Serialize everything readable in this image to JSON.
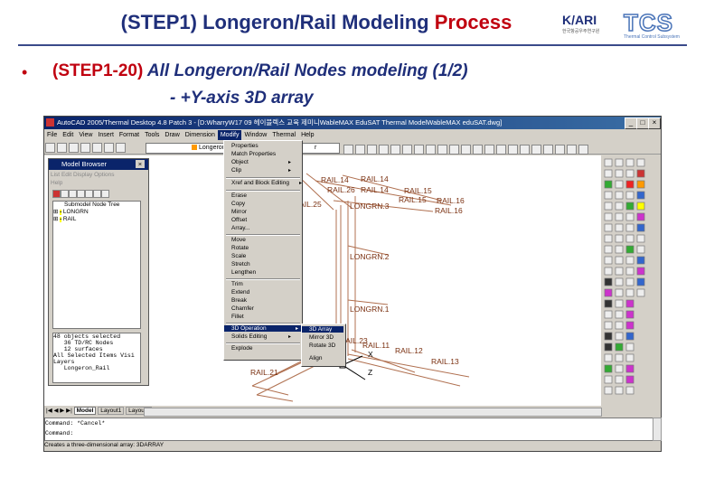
{
  "slide": {
    "title_prefix": "(STEP1) Longeron/Rail Modeling ",
    "title_highlight": "Process",
    "bullet": "•",
    "step_label": "(STEP1-20)",
    "step_text": " All Longeron/Rail Nodes modeling (1/2)",
    "sub_text": "- +Y-axis 3D array",
    "logo_kari": "K/ARI",
    "logo_kari_sub": "한국항공우주연구원",
    "logo_tcs": "TCS",
    "logo_tcs_sub": "Thermal Control Subsystem"
  },
  "window": {
    "title": "AutoCAD 2005/Thermal Desktop 4.8 Patch 3 - [D:WharryW17 09 헤이블렉스 교육 제미니WableMAX EduSAT Thermal ModelWableMAX eduSAT.dwg]",
    "controls": [
      "_",
      "□",
      "×"
    ]
  },
  "menubar": [
    "File",
    "Edit",
    "View",
    "Insert",
    "Format",
    "Tools",
    "Draw",
    "Dimension",
    "Modify",
    "Window",
    "Thermal",
    "Help"
  ],
  "toolbar": {
    "layer": "Longeron_Rail",
    "combo2": "r"
  },
  "model_browser": {
    "title": "Model Browser",
    "menu": [
      "List",
      "Edit",
      "Display",
      "Options",
      "Help"
    ],
    "tree_title": "Submodel Node Tree",
    "tree_items": [
      "LONGRN",
      "RAIL"
    ],
    "info": "48 objects selected\n   36 TD/RC Nodes\n   12 surfaces\nAll Selected Items Visi\nLayers\n   Longeron_Rail"
  },
  "modify_menu": {
    "items": [
      "Properties",
      "Match Properties",
      "Object",
      "Clip",
      "Xref and Block Editing",
      "Erase",
      "Copy",
      "Mirror",
      "Offset",
      "Array...",
      "Move",
      "Rotate",
      "Scale",
      "Stretch",
      "Lengthen",
      "Trim",
      "Extend",
      "Break",
      "Chamfer",
      "Fillet",
      "3D Operation",
      "Solids Editing",
      "Explode"
    ]
  },
  "submenu": {
    "items": [
      "3D Array",
      "Mirror 3D",
      "Rotate 3D",
      "Align"
    ]
  },
  "drawing_labels": [
    "RAIL.14",
    "RAIL.26",
    "RAIL.15",
    "RAIL.16",
    "RAIL.25",
    "LONGRN.3",
    "LONGRN.2",
    "LONGRN.1",
    "RAIL.11",
    "RAIL.12",
    "RAIL.13",
    "RAIL.21",
    "RAIL.23",
    "X",
    "Z"
  ],
  "tabs": [
    "Model",
    "Layout1",
    "Layout2"
  ],
  "command": {
    "line1": "Command: *Cancel*",
    "line2": "Command:"
  },
  "status": "Creates a three-dimensional array: 3DARRAY",
  "colors": {
    "title_blue": "#1f2f7a",
    "accent_red": "#c0000f",
    "menu_highlight": "#0a246a",
    "rail_lines": "#b07050"
  }
}
